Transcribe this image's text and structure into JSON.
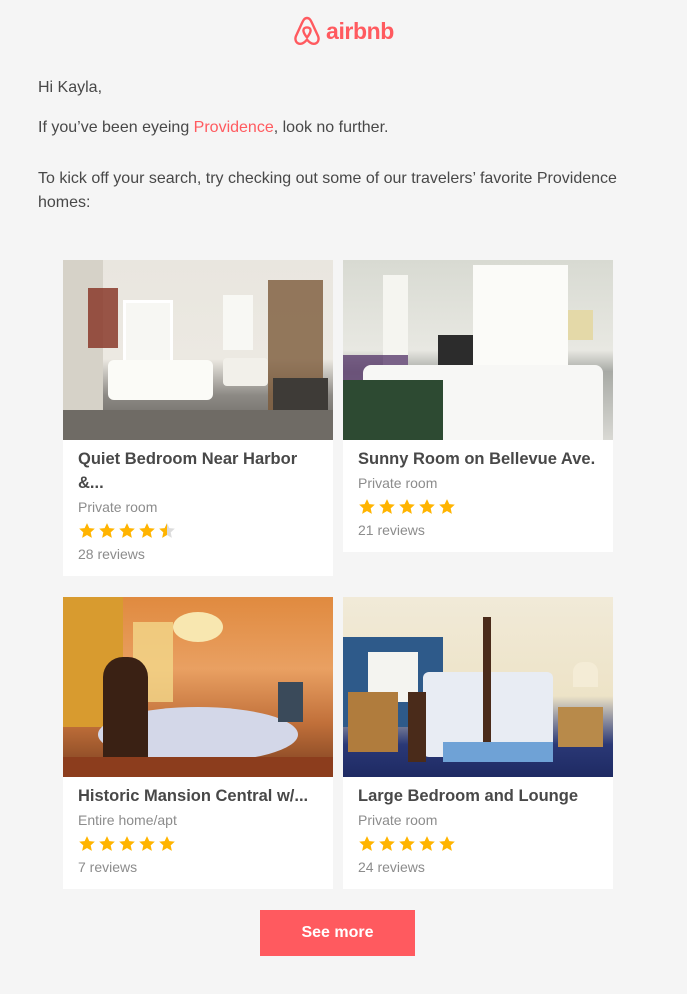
{
  "brand": {
    "name": "airbnb",
    "color": "#ff5a5f"
  },
  "greeting": "Hi Kayla,",
  "intro": {
    "before": "If you’ve been eyeing ",
    "city": "Providence",
    "after": ", look no further."
  },
  "body_text": "To kick off your search, try checking out some of our travelers’ favorite Providence homes:",
  "listings": [
    {
      "title": "Quiet Bedroom Near Harbor &...",
      "type": "Private room",
      "rating": 4.5,
      "reviews": "28 reviews"
    },
    {
      "title": "Sunny Room on Bellevue Ave.",
      "type": "Private room",
      "rating": 5,
      "reviews": "21 reviews"
    },
    {
      "title": "Historic Mansion Central w/...",
      "type": "Entire home/apt",
      "rating": 5,
      "reviews": "7 reviews"
    },
    {
      "title": "Large Bedroom and Lounge",
      "type": "Private room",
      "rating": 5,
      "reviews": "24 reviews"
    }
  ],
  "star_color": "#ffb400",
  "see_more_label": "See more"
}
